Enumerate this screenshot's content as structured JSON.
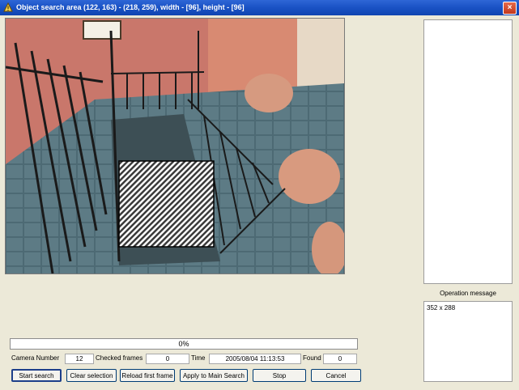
{
  "window": {
    "title": "Object search area (122, 163) - (218, 259), width - [96], height - [96]",
    "close_glyph": "×"
  },
  "icons": {
    "title": "app-icon",
    "close": "close-icon"
  },
  "progress": {
    "label": "0%",
    "percent": 0
  },
  "info": {
    "camera_number_label": "Camera Number",
    "camera_number_value": "12",
    "checked_frames_label": "Checked frames",
    "checked_frames_value": "0",
    "time_label": "Time",
    "time_value": "2005/08/04 11:13:53",
    "found_label": "Found",
    "found_value": "0"
  },
  "buttons": {
    "start_search": "Start search",
    "clear_selection": "Clear selection",
    "reload_first_frame": "Reload first frame",
    "apply_to_main_search": "Apply to Main Search",
    "stop": "Stop",
    "cancel": "Cancel"
  },
  "operation": {
    "label": "Operation message",
    "message": "352 x 288"
  },
  "colors": {
    "title_bar": "#1a52c4",
    "window_bg": "#ece9d8",
    "selection_border": "#000000"
  }
}
